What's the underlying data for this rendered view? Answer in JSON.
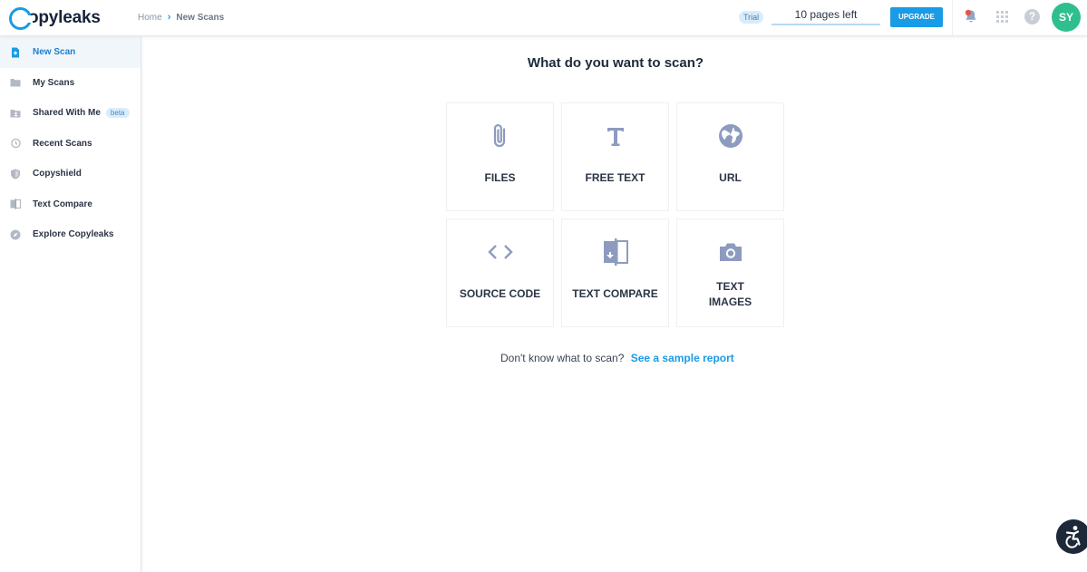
{
  "header": {
    "logo_text": "opyleaks",
    "breadcrumb": {
      "home": "Home",
      "separator": "›",
      "current": "New Scans"
    },
    "trial_badge": "Trial",
    "pages_left": "10 pages left",
    "upgrade_label": "UPGRADE",
    "help_symbol": "?",
    "avatar_initials": "SY",
    "accent_color": "#1a9be6",
    "avatar_color": "#2fbf8f"
  },
  "sidebar": {
    "items": [
      {
        "label": "New Scan",
        "icon": "new-file-icon",
        "active": true
      },
      {
        "label": "My Scans",
        "icon": "folder-icon"
      },
      {
        "label": "Shared With Me",
        "icon": "shared-folder-icon",
        "badge": "beta"
      },
      {
        "label": "Recent Scans",
        "icon": "history-icon"
      },
      {
        "label": "Copyshield",
        "icon": "shield-icon"
      },
      {
        "label": "Text Compare",
        "icon": "compare-icon"
      },
      {
        "label": "Explore Copyleaks",
        "icon": "compass-icon"
      }
    ]
  },
  "main": {
    "title": "What do you want to scan?",
    "tiles": [
      {
        "label": "FILES",
        "icon": "paperclip-icon"
      },
      {
        "label": "FREE TEXT",
        "icon": "text-t-icon"
      },
      {
        "label": "URL",
        "icon": "globe-icon"
      },
      {
        "label": "SOURCE CODE",
        "icon": "code-brackets-icon"
      },
      {
        "label": "TEXT COMPARE",
        "icon": "compare-icon"
      },
      {
        "label_line1": "TEXT",
        "label_line2": "IMAGES",
        "icon": "camera-icon"
      }
    ],
    "sample_prompt": "Don't know what to scan?",
    "sample_link": "See a sample report"
  }
}
